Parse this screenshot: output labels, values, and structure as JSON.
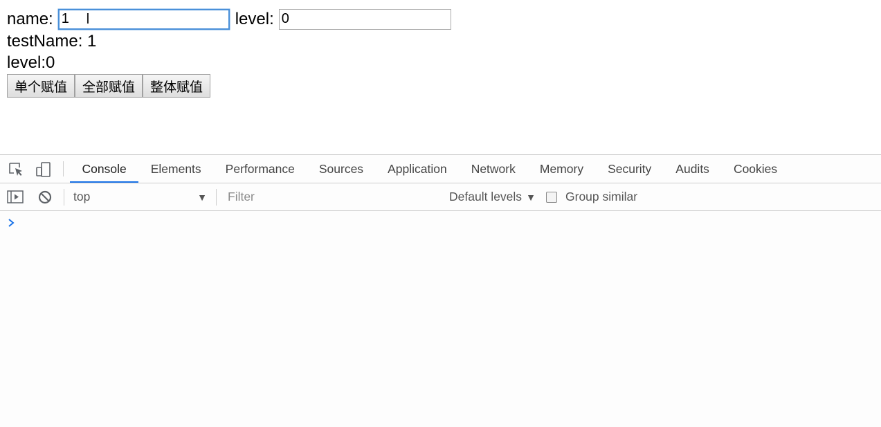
{
  "page": {
    "name_label": "name:",
    "name_value": "1",
    "level_label": "level:",
    "level_value": "0",
    "test_name_line": "testName: 1",
    "level_line": "level:0",
    "buttons": [
      "单个赋值",
      "全部赋值",
      "整体赋值"
    ]
  },
  "devtools": {
    "tabs": [
      {
        "label": "Console",
        "active": true
      },
      {
        "label": "Elements",
        "active": false
      },
      {
        "label": "Performance",
        "active": false
      },
      {
        "label": "Sources",
        "active": false
      },
      {
        "label": "Application",
        "active": false
      },
      {
        "label": "Network",
        "active": false
      },
      {
        "label": "Memory",
        "active": false
      },
      {
        "label": "Security",
        "active": false
      },
      {
        "label": "Audits",
        "active": false
      },
      {
        "label": "Cookies",
        "active": false
      }
    ],
    "toolbar": {
      "context": "top",
      "filter_placeholder": "Filter",
      "levels_label": "Default levels",
      "group_similar_label": "Group similar"
    },
    "icons": {
      "inspect": "inspect-element-icon",
      "device": "device-toolbar-icon",
      "sidebar": "show-sidebar-icon",
      "clear": "clear-console-icon",
      "prompt": "console-prompt-icon"
    },
    "colors": {
      "active_tab_underline": "#1a73e8",
      "prompt": "#1a73e8",
      "focused_input_border": "#4a90d9"
    }
  }
}
